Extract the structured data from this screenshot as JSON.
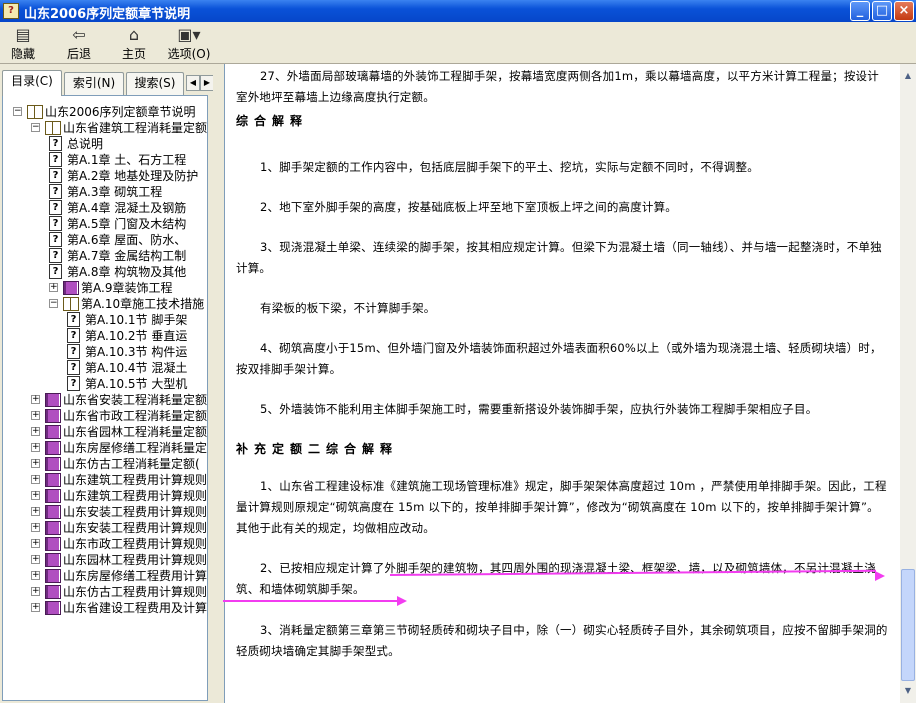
{
  "window": {
    "title": "山东2006序列定额章节说明",
    "icon": "help-book-icon",
    "minimize": "_",
    "maximize": "□",
    "close": "×"
  },
  "toolbar": [
    {
      "label": "隐藏",
      "icon": "hide-pane-icon"
    },
    {
      "label": "后退",
      "icon": "back-arrow-icon"
    },
    {
      "label": "主页",
      "icon": "home-icon"
    },
    {
      "label": "选项(O)",
      "icon": "options-icon"
    }
  ],
  "tabs": {
    "items": [
      "目录(C)",
      "索引(N)",
      "搜索(S)"
    ],
    "active": "目录(C)"
  },
  "tree": [
    {
      "label": "山东2006序列定额章节说明",
      "level": 0,
      "type": "book-open",
      "expander": "−"
    },
    {
      "label": "山东省建筑工程消耗量定额",
      "level": 1,
      "type": "book-open",
      "expander": "−"
    },
    {
      "label": "总说明",
      "level": 2,
      "type": "page"
    },
    {
      "label": "第A.1章 土、石方工程",
      "level": 2,
      "type": "page"
    },
    {
      "label": "第A.2章 地基处理及防护",
      "level": 2,
      "type": "page"
    },
    {
      "label": "第A.3章 砌筑工程",
      "level": 2,
      "type": "page"
    },
    {
      "label": "第A.4章 混凝土及钢筋",
      "level": 2,
      "type": "page"
    },
    {
      "label": "第A.5章 门窗及木结构",
      "level": 2,
      "type": "page"
    },
    {
      "label": "第A.6章 屋面、防水、",
      "level": 2,
      "type": "page"
    },
    {
      "label": "第A.7章 金属结构工制",
      "level": 2,
      "type": "page"
    },
    {
      "label": "第A.8章 构筑物及其他",
      "level": 2,
      "type": "page"
    },
    {
      "label": "第A.9章装饰工程",
      "level": 2,
      "type": "book-closed",
      "expander": "+"
    },
    {
      "label": "第A.10章施工技术措施",
      "level": 2,
      "type": "book-open",
      "expander": "−"
    },
    {
      "label": "第A.10.1节 脚手架",
      "level": 3,
      "type": "page"
    },
    {
      "label": "第A.10.2节 垂直运",
      "level": 3,
      "type": "page"
    },
    {
      "label": "第A.10.3节 构件运",
      "level": 3,
      "type": "page"
    },
    {
      "label": "第A.10.4节 混凝土",
      "level": 3,
      "type": "page"
    },
    {
      "label": "第A.10.5节 大型机",
      "level": 3,
      "type": "page"
    },
    {
      "label": "山东省安装工程消耗量定额",
      "level": 1,
      "type": "book-closed",
      "expander": "+"
    },
    {
      "label": "山东省市政工程消耗量定额",
      "level": 1,
      "type": "book-closed",
      "expander": "+"
    },
    {
      "label": "山东省园林工程消耗量定额",
      "level": 1,
      "type": "book-closed",
      "expander": "+"
    },
    {
      "label": "山东房屋修缮工程消耗量定",
      "level": 1,
      "type": "book-closed",
      "expander": "+"
    },
    {
      "label": "山东仿古工程消耗量定额(",
      "level": 1,
      "type": "book-closed",
      "expander": "+"
    },
    {
      "label": "山东建筑工程费用计算规则",
      "level": 1,
      "type": "book-closed",
      "expander": "+"
    },
    {
      "label": "山东建筑工程费用计算规则",
      "level": 1,
      "type": "book-closed",
      "expander": "+"
    },
    {
      "label": "山东安装工程费用计算规则",
      "level": 1,
      "type": "book-closed",
      "expander": "+"
    },
    {
      "label": "山东安装工程费用计算规则",
      "level": 1,
      "type": "book-closed",
      "expander": "+"
    },
    {
      "label": "山东市政工程费用计算规则",
      "level": 1,
      "type": "book-closed",
      "expander": "+"
    },
    {
      "label": "山东园林工程费用计算规则",
      "level": 1,
      "type": "book-closed",
      "expander": "+"
    },
    {
      "label": "山东房屋修缮工程费用计算",
      "level": 1,
      "type": "book-closed",
      "expander": "+"
    },
    {
      "label": "山东仿古工程费用计算规则",
      "level": 1,
      "type": "book-closed",
      "expander": "+"
    },
    {
      "label": "山东省建设工程费用及计算",
      "level": 1,
      "type": "book-closed",
      "expander": "+"
    }
  ],
  "content": {
    "p27": "27、外墙面局部玻璃幕墙的外装饰工程脚手架，按幕墙宽度两侧各加1m，乘以幕墙高度，以平方米计算工程量；按设计室外地坪至幕墙上边缘高度执行定额。",
    "heading1": "综合解释",
    "c1": "1、脚手架定额的工作内容中，包括底层脚手架下的平土、挖坑，实际与定额不同时，不得调整。",
    "c2": "2、地下室外脚手架的高度，按基础底板上坪至地下室顶板上坪之间的高度计算。",
    "c3": "3、现浇混凝土单梁、连续梁的脚手架，按其相应规定计算。但梁下为混凝土墙（同一轴线）、并与墙一起整浇时，不单独计算。",
    "c3b": "有梁板的板下梁，不计算脚手架。",
    "c4": "4、砌筑高度小于15m、但外墙门窗及外墙装饰面积超过外墙表面积60%以上（或外墙为现浇混土墙、轻质砌块墙）时，按双排脚手架计算。",
    "c5": "5、外墙装饰不能利用主体脚手架施工时，需要重新搭设外装饰脚手架，应执行外装饰工程脚手架相应子目。",
    "heading2": "补充定额二综合解释",
    "s1": "1、山东省工程建设标准《建筑施工现场管理标准》规定，脚手架架体高度超过 10m ，严禁使用单排脚手架。因此，工程量计算规则原规定“砌筑高度在 15m 以下的，按单排脚手架计算”，修改为“砌筑高度在 10m 以下的，按单排脚手架计算”。其他于此有关的规定，均做相应改动。",
    "s2": "2、已按相应规定计算了外脚手架的建筑物，其四周外围的现浇混凝土梁、框架梁、墙，以及砌筑墙体，不另计混凝土浇筑、和墙体砌筑脚手架。",
    "s3": "3、消耗量定额第三章第三节砌轻质砖和砌块子目中，除（一）砌实心轻质砖子目外，其余砌筑项目，应按不留脚手架洞的轻质砌块墙确定其脚手架型式。"
  },
  "annotation": {
    "color": "#f23cf0",
    "type": "magenta-arrow"
  }
}
